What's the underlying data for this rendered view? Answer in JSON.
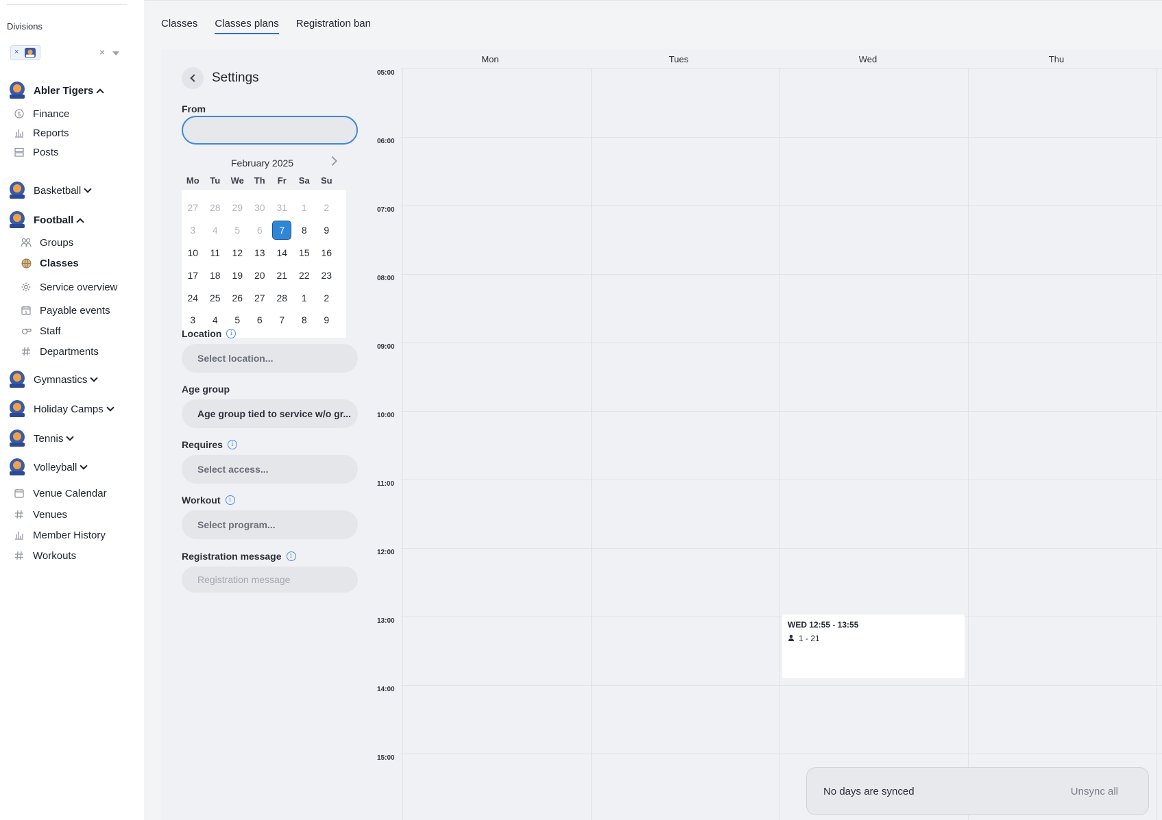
{
  "sidebar": {
    "divisions_label": "Divisions",
    "division_chip_remove": "×",
    "division_clear": "×",
    "teams": [
      {
        "name": "Abler Tigers",
        "expanded": true
      },
      {
        "name": "Basketball",
        "expanded": false
      },
      {
        "name": "Football",
        "expanded": true
      },
      {
        "name": "Gymnastics",
        "expanded": false
      },
      {
        "name": "Holiday Camps",
        "expanded": false
      },
      {
        "name": "Tennis",
        "expanded": false
      },
      {
        "name": "Volleyball",
        "expanded": false
      }
    ],
    "abler_items": [
      {
        "label": "Finance",
        "icon": "dollar-icon"
      },
      {
        "label": "Reports",
        "icon": "bar-chart-icon"
      },
      {
        "label": "Posts",
        "icon": "posts-icon"
      }
    ],
    "football_items": [
      {
        "label": "Groups",
        "icon": "users-icon"
      },
      {
        "label": "Classes",
        "icon": "globe-icon",
        "active": true
      },
      {
        "label": "Service overview",
        "icon": "gear-icon"
      },
      {
        "label": "Payable events",
        "icon": "dollar-calendar-icon"
      },
      {
        "label": "Staff",
        "icon": "whistle-icon"
      },
      {
        "label": "Departments",
        "icon": "hash-icon"
      }
    ],
    "bottom_items": [
      {
        "label": "Venue Calendar",
        "icon": "calendar-icon"
      },
      {
        "label": "Venues",
        "icon": "hash-icon"
      },
      {
        "label": "Member History",
        "icon": "bar-chart-icon"
      },
      {
        "label": "Workouts",
        "icon": "hash-icon"
      }
    ]
  },
  "tabs": [
    {
      "label": "Classes",
      "active": false
    },
    {
      "label": "Classes plans",
      "active": true
    },
    {
      "label": "Registration ban",
      "active": false
    }
  ],
  "settings": {
    "title": "Settings",
    "from_label": "From",
    "from_value": "",
    "calendar": {
      "month": "February 2025",
      "dow": [
        "Mo",
        "Tu",
        "We",
        "Th",
        "Fr",
        "Sa",
        "Su"
      ],
      "weeks": [
        [
          {
            "d": "27",
            "m": true
          },
          {
            "d": "28",
            "m": true
          },
          {
            "d": "29",
            "m": true
          },
          {
            "d": "30",
            "m": true
          },
          {
            "d": "31",
            "m": true
          },
          {
            "d": "1",
            "m": true
          },
          {
            "d": "2",
            "m": true
          }
        ],
        [
          {
            "d": "3",
            "m": true
          },
          {
            "d": "4",
            "m": true
          },
          {
            "d": "5",
            "m": true
          },
          {
            "d": "6",
            "m": true
          },
          {
            "d": "7",
            "sel": true
          },
          {
            "d": "8"
          },
          {
            "d": "9"
          }
        ],
        [
          {
            "d": "10"
          },
          {
            "d": "11"
          },
          {
            "d": "12"
          },
          {
            "d": "13"
          },
          {
            "d": "14"
          },
          {
            "d": "15"
          },
          {
            "d": "16"
          }
        ],
        [
          {
            "d": "17"
          },
          {
            "d": "18"
          },
          {
            "d": "19"
          },
          {
            "d": "20"
          },
          {
            "d": "21"
          },
          {
            "d": "22"
          },
          {
            "d": "23"
          }
        ],
        [
          {
            "d": "24"
          },
          {
            "d": "25"
          },
          {
            "d": "26"
          },
          {
            "d": "27"
          },
          {
            "d": "28"
          },
          {
            "d": "1"
          },
          {
            "d": "2"
          }
        ],
        [
          {
            "d": "3"
          },
          {
            "d": "4"
          },
          {
            "d": "5"
          },
          {
            "d": "6"
          },
          {
            "d": "7"
          },
          {
            "d": "8"
          },
          {
            "d": "9"
          }
        ]
      ]
    },
    "location_label": "Location",
    "location_placeholder": "Select location...",
    "age_group_label": "Age group",
    "age_group_value": "Age group tied to service w/o gr...",
    "requires_label": "Requires",
    "requires_placeholder": "Select access...",
    "workout_label": "Workout",
    "workout_placeholder": "Select program...",
    "reg_message_label": "Registration message",
    "reg_message_placeholder": "Registration message",
    "info_glyph": "i"
  },
  "week": {
    "days": [
      "Mon",
      "Tues",
      "Wed",
      "Thu"
    ],
    "times": [
      "05:00",
      "06:00",
      "07:00",
      "08:00",
      "09:00",
      "10:00",
      "11:00",
      "12:00",
      "13:00",
      "14:00",
      "15:00"
    ],
    "event": {
      "title": "WED 12:55 - 13:55",
      "capacity": "1 - 21"
    }
  },
  "sync": {
    "message": "No days are synced",
    "button": "Unsync all"
  },
  "colors": {
    "accent": "#2b6fd6",
    "selected_day": "#2f86d6",
    "sidebar_bg": "#ffffff",
    "main_bg": "#f3f4f6"
  }
}
